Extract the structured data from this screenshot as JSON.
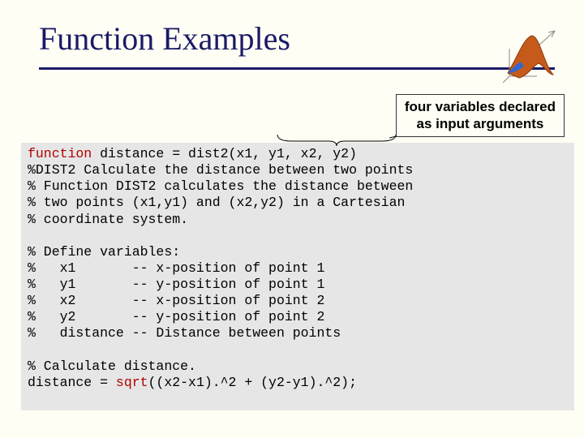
{
  "title": "Function Examples",
  "callout": {
    "line1": "four variables declared",
    "line2": "as input arguments"
  },
  "code": {
    "kw_function": "function",
    "l1": "distance = dist2(x1, y1, x2, y2)",
    "l2": "%DIST2 Calculate the distance between two points",
    "l3": "% Function DIST2 calculates the distance between",
    "l4": "% two points (x1,y1) and (x2,y2) in a Cartesian",
    "l5": "% coordinate system.",
    "l6": "% Define variables:",
    "l7": "%   x1       -- x-position of point 1",
    "l8": "%   y1       -- y-position of point 1",
    "l9": "%   x2       -- x-position of point 2",
    "l10": "%   y2       -- y-position of point 2",
    "l11": "%   distance -- Distance between points",
    "l12": "% Calculate distance.",
    "l13a": "distance = ",
    "kw_sqrt": "sqrt",
    "l13b": "((x2-x1).^2 + (y2-y1).^2);"
  }
}
